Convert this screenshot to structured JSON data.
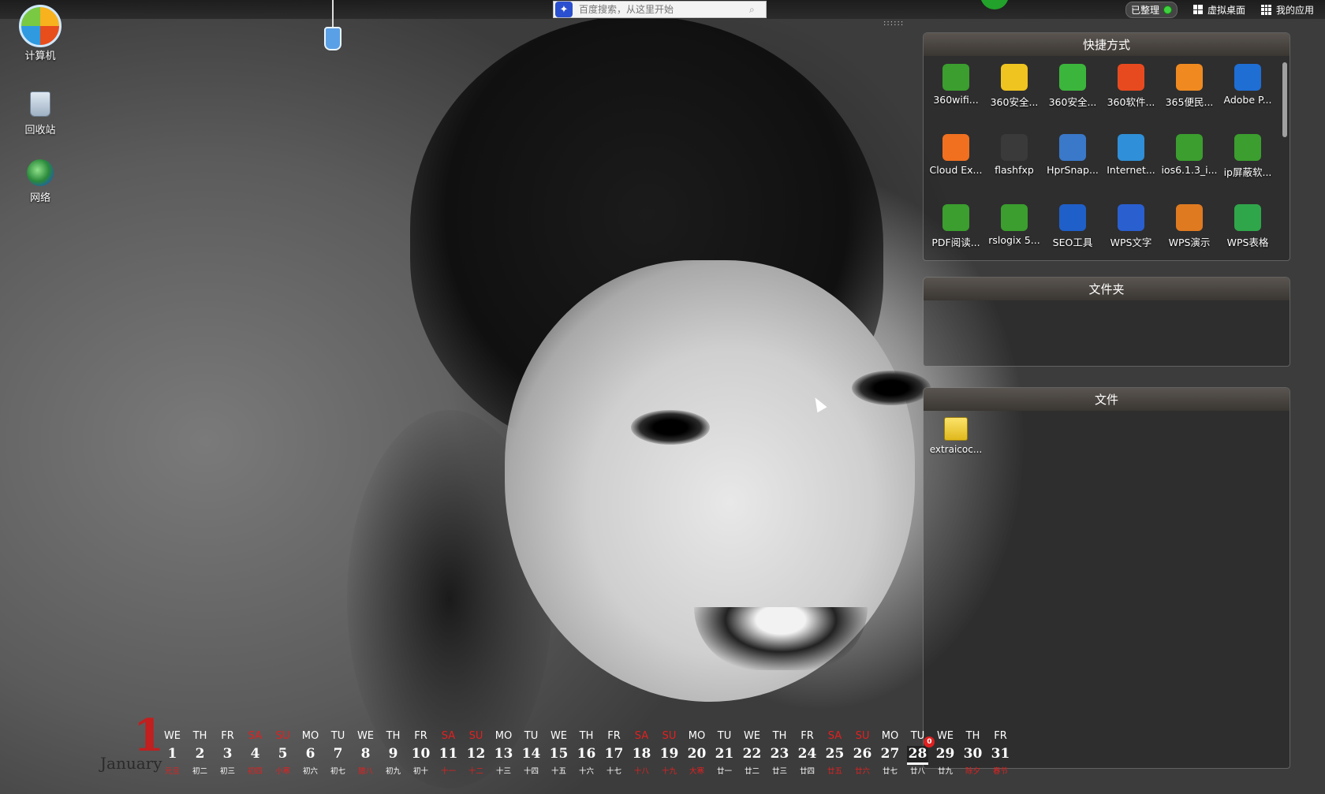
{
  "topbar": {
    "search_placeholder": "百度搜索，从这里开始",
    "organized_label": "已整理",
    "virtual_desktop_label": "虚拟桌面",
    "my_apps_label": "我的应用"
  },
  "desktop_icons": [
    {
      "label": "计算机",
      "icon": "computer-icon"
    },
    {
      "label": "回收站",
      "icon": "recycle-bin-icon"
    },
    {
      "label": "网络",
      "icon": "network-icon"
    }
  ],
  "panels": {
    "shortcuts": {
      "title": "快捷方式",
      "items": [
        {
          "label": "360wifi...",
          "icon": "360wifi-icon",
          "color": "#3b9e2e"
        },
        {
          "label": "360安全...",
          "icon": "360-safe-guard-icon",
          "color": "#f0c420"
        },
        {
          "label": "360安全...",
          "icon": "360-browser-icon",
          "color": "#3cb53c"
        },
        {
          "label": "360软件...",
          "icon": "360-software-icon",
          "color": "#e84a1f"
        },
        {
          "label": "365便民...",
          "icon": "365-icon",
          "color": "#f08a20"
        },
        {
          "label": "Adobe P...",
          "icon": "photoshop-icon",
          "color": "#1f6ed4"
        },
        {
          "label": "Cloud Ex...",
          "icon": "cloud-explorer-icon",
          "color": "#f07020"
        },
        {
          "label": "flashfxp",
          "icon": "flashfxp-icon",
          "color": "#3a3a3a"
        },
        {
          "label": "HprSnap...",
          "icon": "hprsnap-icon",
          "color": "#3a78c9"
        },
        {
          "label": "Internet...",
          "icon": "internet-explorer-icon",
          "color": "#2f8fd8"
        },
        {
          "label": "ios6.1.3_i...",
          "icon": "ios-icon",
          "color": "#3b9e2e"
        },
        {
          "label": "ip屏蔽软...",
          "icon": "ip-block-icon",
          "color": "#3b9e2e"
        },
        {
          "label": "PDF阅读...",
          "icon": "pdf-reader-icon",
          "color": "#3b9e2e"
        },
        {
          "label": "rslogix 5...",
          "icon": "rslogix-icon",
          "color": "#3b9e2e"
        },
        {
          "label": "SEO工具",
          "icon": "seo-tool-icon",
          "color": "#1f5fc9"
        },
        {
          "label": "WPS文字",
          "icon": "wps-writer-icon",
          "color": "#2a5fd0"
        },
        {
          "label": "WPS演示",
          "icon": "wps-presentation-icon",
          "color": "#e07a20"
        },
        {
          "label": "WPS表格",
          "icon": "wps-spreadsheet-icon",
          "color": "#2fa64a"
        }
      ]
    },
    "folders": {
      "title": "文件夹"
    },
    "files": {
      "title": "文件",
      "items": [
        {
          "label": "extraicoc...",
          "icon": "folder-file-icon"
        }
      ]
    }
  },
  "calendar": {
    "month_number": "1",
    "month_name": "January",
    "days": [
      {
        "wd": "WE",
        "d": "1",
        "lu": "元旦",
        "red": false,
        "red_lunar": true
      },
      {
        "wd": "TH",
        "d": "2",
        "lu": "初二",
        "red": false
      },
      {
        "wd": "FR",
        "d": "3",
        "lu": "初三",
        "red": false
      },
      {
        "wd": "SA",
        "d": "4",
        "lu": "初四",
        "red": true,
        "red_lunar": false
      },
      {
        "wd": "SU",
        "d": "5",
        "lu": "小寒",
        "red": true
      },
      {
        "wd": "MO",
        "d": "6",
        "lu": "初六",
        "red": false
      },
      {
        "wd": "TU",
        "d": "7",
        "lu": "初七",
        "red": false
      },
      {
        "wd": "WE",
        "d": "8",
        "lu": "腊八",
        "red": false,
        "red_lunar": true
      },
      {
        "wd": "TH",
        "d": "9",
        "lu": "初九",
        "red": false
      },
      {
        "wd": "FR",
        "d": "10",
        "lu": "初十",
        "red": false
      },
      {
        "wd": "SA",
        "d": "11",
        "lu": "十一",
        "red": true,
        "red_lunar": false
      },
      {
        "wd": "SU",
        "d": "12",
        "lu": "十二",
        "red": true,
        "red_lunar": false
      },
      {
        "wd": "MO",
        "d": "13",
        "lu": "十三",
        "red": false
      },
      {
        "wd": "TU",
        "d": "14",
        "lu": "十四",
        "red": false
      },
      {
        "wd": "WE",
        "d": "15",
        "lu": "十五",
        "red": false
      },
      {
        "wd": "TH",
        "d": "16",
        "lu": "十六",
        "red": false
      },
      {
        "wd": "FR",
        "d": "17",
        "lu": "十七",
        "red": false
      },
      {
        "wd": "SA",
        "d": "18",
        "lu": "十八",
        "red": true,
        "red_lunar": false
      },
      {
        "wd": "SU",
        "d": "19",
        "lu": "十九",
        "red": true,
        "red_lunar": false
      },
      {
        "wd": "MO",
        "d": "20",
        "lu": "大寒",
        "red": false,
        "red_lunar": true
      },
      {
        "wd": "TU",
        "d": "21",
        "lu": "廿一",
        "red": false
      },
      {
        "wd": "WE",
        "d": "22",
        "lu": "廿二",
        "red": false
      },
      {
        "wd": "TH",
        "d": "23",
        "lu": "廿三",
        "red": false
      },
      {
        "wd": "FR",
        "d": "24",
        "lu": "廿四",
        "red": false
      },
      {
        "wd": "SA",
        "d": "25",
        "lu": "廿五",
        "red": true,
        "red_lunar": false
      },
      {
        "wd": "SU",
        "d": "26",
        "lu": "廿六",
        "red": true,
        "red_lunar": false
      },
      {
        "wd": "MO",
        "d": "27",
        "lu": "廿七",
        "red": false
      },
      {
        "wd": "TU",
        "d": "28",
        "lu": "廿八",
        "red": false,
        "today": true,
        "badge": "0"
      },
      {
        "wd": "WE",
        "d": "29",
        "lu": "廿九",
        "red": false
      },
      {
        "wd": "TH",
        "d": "30",
        "lu": "除夕",
        "red": false,
        "red_lunar": true
      },
      {
        "wd": "FR",
        "d": "31",
        "lu": "春节",
        "red": false,
        "red_lunar": true
      }
    ]
  }
}
